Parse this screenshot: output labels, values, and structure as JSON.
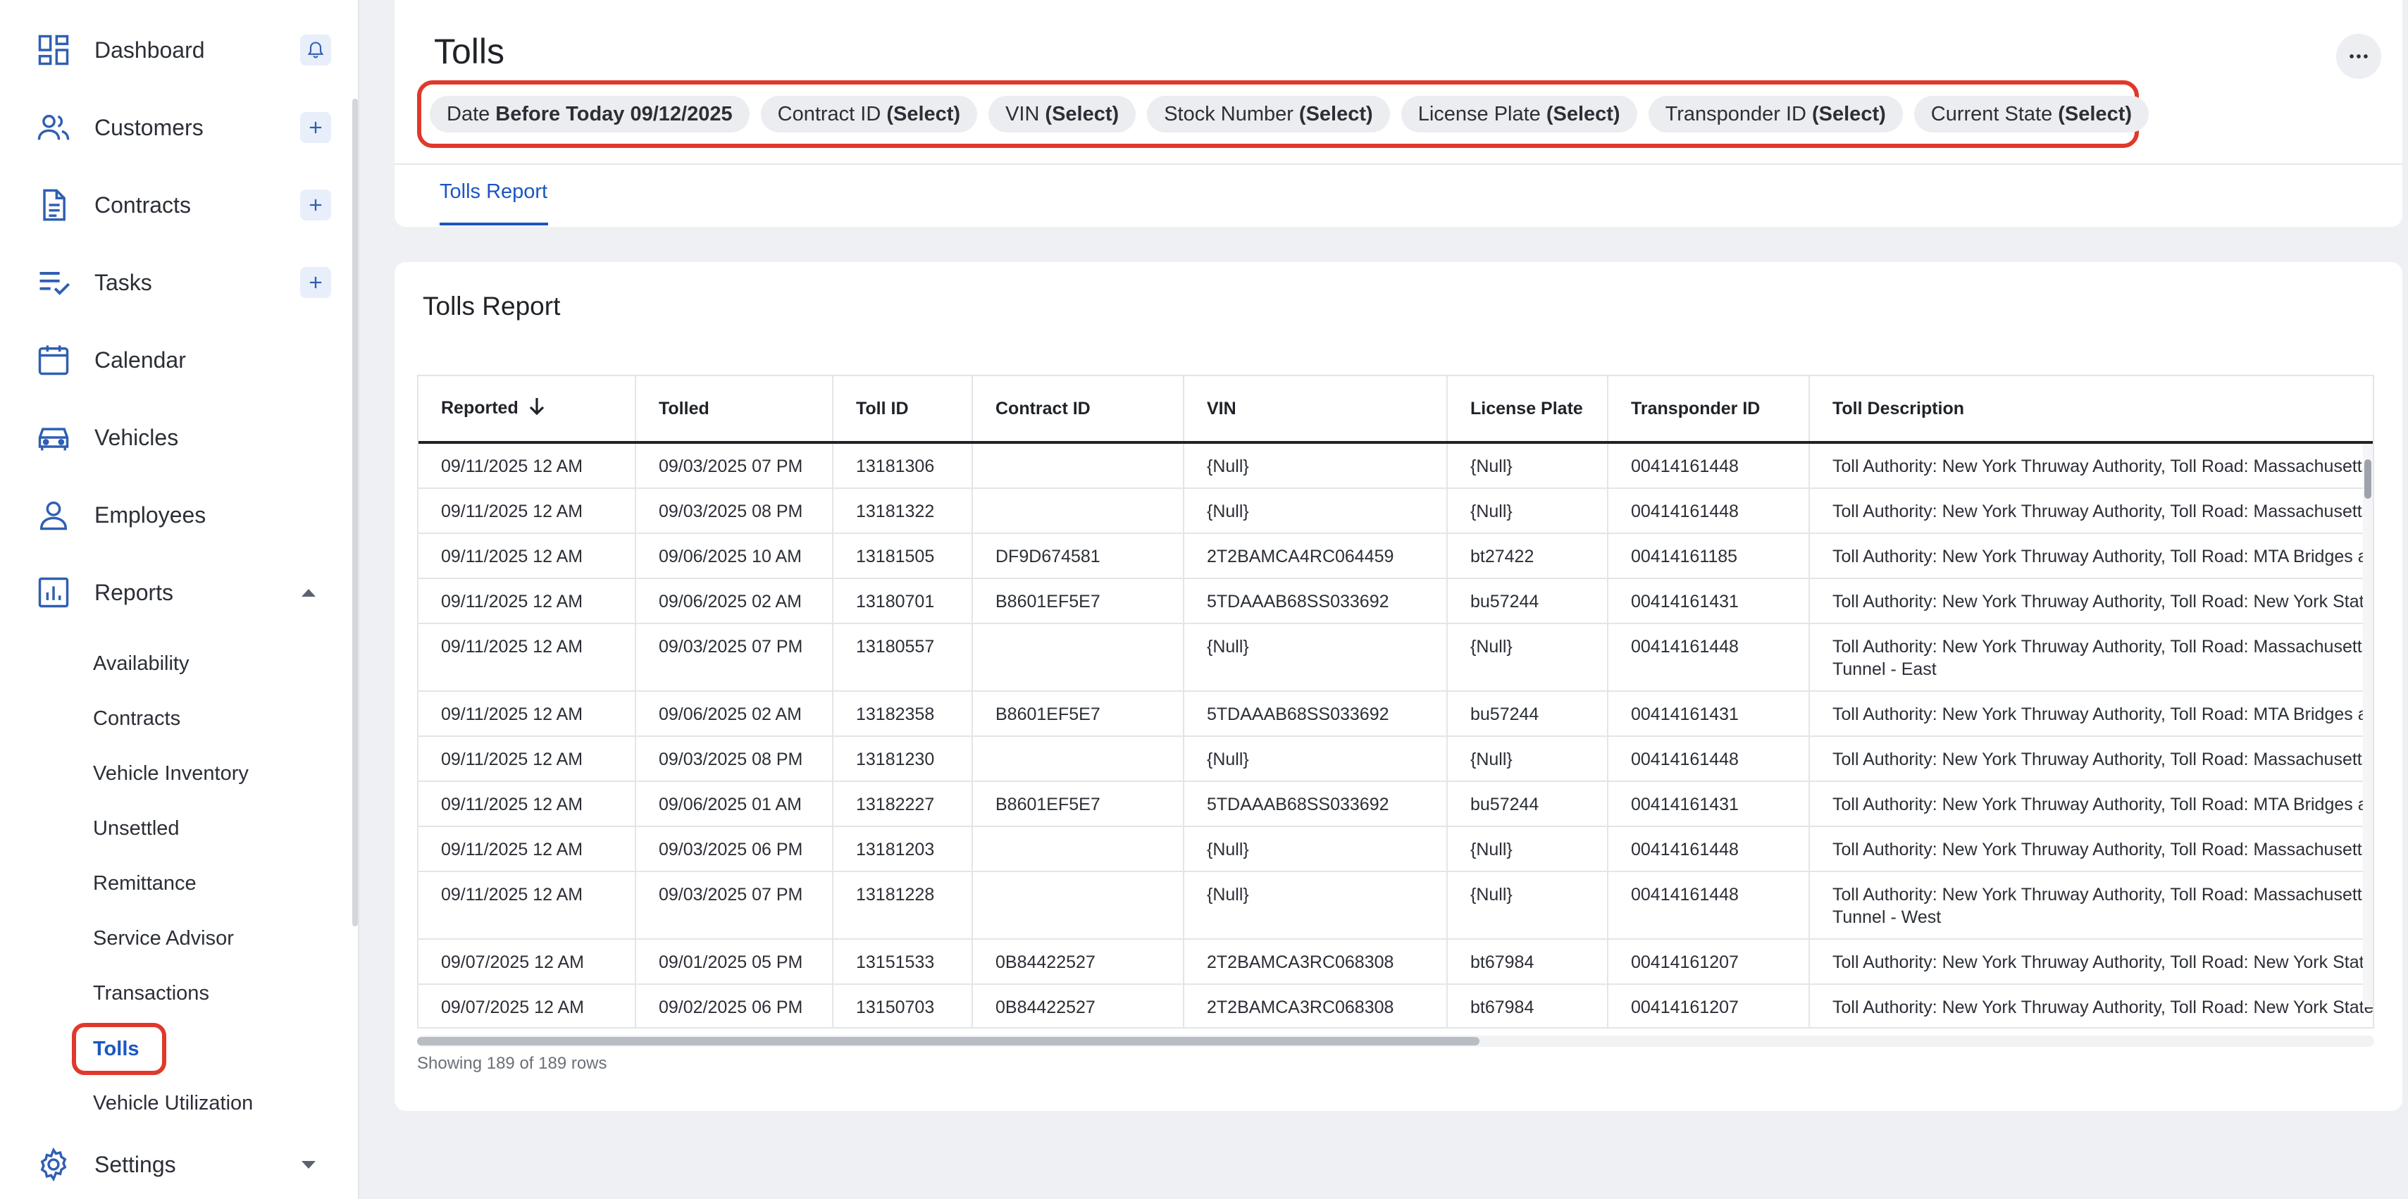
{
  "sidebar": {
    "items": [
      {
        "label": "Dashboard",
        "icon": "dashboard-icon",
        "action": "bell-icon"
      },
      {
        "label": "Customers",
        "icon": "customers-icon",
        "action": "plus-icon"
      },
      {
        "label": "Contracts",
        "icon": "contracts-icon",
        "action": "plus-icon"
      },
      {
        "label": "Tasks",
        "icon": "tasks-icon",
        "action": "plus-icon"
      },
      {
        "label": "Calendar",
        "icon": "calendar-icon"
      },
      {
        "label": "Vehicles",
        "icon": "car-icon"
      },
      {
        "label": "Employees",
        "icon": "person-icon"
      },
      {
        "label": "Reports",
        "icon": "chart-icon",
        "expanded": true
      },
      {
        "label": "Settings",
        "icon": "gear-icon",
        "expanded": false
      }
    ],
    "reports_subitems": [
      {
        "label": "Availability"
      },
      {
        "label": "Contracts"
      },
      {
        "label": "Vehicle Inventory"
      },
      {
        "label": "Unsettled"
      },
      {
        "label": "Remittance"
      },
      {
        "label": "Service Advisor"
      },
      {
        "label": "Transactions"
      },
      {
        "label": "Tolls",
        "active": true
      },
      {
        "label": "Vehicle Utilization"
      }
    ]
  },
  "header": {
    "title": "Tolls",
    "filters": [
      {
        "name": "Date",
        "value": "Before Today 09/12/2025"
      },
      {
        "name": "Contract ID",
        "value": "(Select)"
      },
      {
        "name": "VIN",
        "value": "(Select)"
      },
      {
        "name": "Stock Number",
        "value": "(Select)"
      },
      {
        "name": "License Plate",
        "value": "(Select)"
      },
      {
        "name": "Transponder ID",
        "value": "(Select)"
      },
      {
        "name": "Current State",
        "value": "(Select)"
      }
    ],
    "tab": "Tolls Report"
  },
  "report": {
    "title": "Tolls Report",
    "columns": [
      "Reported",
      "Tolled",
      "Toll ID",
      "Contract ID",
      "VIN",
      "License Plate",
      "Transponder ID",
      "Toll Description"
    ],
    "rows": [
      [
        "09/11/2025 12 AM",
        "09/03/2025 07 PM",
        "13181306",
        "",
        "{Null}",
        "{Null}",
        "00414161448",
        "Toll Authority: New York Thruway Authority, Toll Road: Massachusetts T"
      ],
      [
        "09/11/2025 12 AM",
        "09/03/2025 08 PM",
        "13181322",
        "",
        "{Null}",
        "{Null}",
        "00414161448",
        "Toll Authority: New York Thruway Authority, Toll Road: Massachusetts T"
      ],
      [
        "09/11/2025 12 AM",
        "09/06/2025 10 AM",
        "13181505",
        "DF9D674581",
        "2T2BAMCA4RC064459",
        "bt27422",
        "00414161185",
        "Toll Authority: New York Thruway Authority, Toll Road: MTA Bridges and"
      ],
      [
        "09/11/2025 12 AM",
        "09/06/2025 02 AM",
        "13180701",
        "B8601EF5E7",
        "5TDAAAB68SS033692",
        "bu57244",
        "00414161431",
        "Toll Authority: New York Thruway Authority, Toll Road: New York State T"
      ],
      [
        "09/11/2025 12 AM",
        "09/03/2025 07 PM",
        "13180557",
        "",
        "{Null}",
        "{Null}",
        "00414161448",
        "Toll Authority: New York Thruway Authority, Toll Road: Massachusetts T\nTunnel - East"
      ],
      [
        "09/11/2025 12 AM",
        "09/06/2025 02 AM",
        "13182358",
        "B8601EF5E7",
        "5TDAAAB68SS033692",
        "bu57244",
        "00414161431",
        "Toll Authority: New York Thruway Authority, Toll Road: MTA Bridges and"
      ],
      [
        "09/11/2025 12 AM",
        "09/03/2025 08 PM",
        "13181230",
        "",
        "{Null}",
        "{Null}",
        "00414161448",
        "Toll Authority: New York Thruway Authority, Toll Road: Massachusetts T"
      ],
      [
        "09/11/2025 12 AM",
        "09/06/2025 01 AM",
        "13182227",
        "B8601EF5E7",
        "5TDAAAB68SS033692",
        "bu57244",
        "00414161431",
        "Toll Authority: New York Thruway Authority, Toll Road: MTA Bridges and"
      ],
      [
        "09/11/2025 12 AM",
        "09/03/2025 06 PM",
        "13181203",
        "",
        "{Null}",
        "{Null}",
        "00414161448",
        "Toll Authority: New York Thruway Authority, Toll Road: Massachusetts T"
      ],
      [
        "09/11/2025 12 AM",
        "09/03/2025 07 PM",
        "13181228",
        "",
        "{Null}",
        "{Null}",
        "00414161448",
        "Toll Authority: New York Thruway Authority, Toll Road: Massachusetts T\nTunnel - West"
      ],
      [
        "09/07/2025 12 AM",
        "09/01/2025 05 PM",
        "13151533",
        "0B84422527",
        "2T2BAMCA3RC068308",
        "bt67984",
        "00414161207",
        "Toll Authority: New York Thruway Authority, Toll Road: New York State T"
      ],
      [
        "09/07/2025 12 AM",
        "09/02/2025 06 PM",
        "13150703",
        "0B84422527",
        "2T2BAMCA3RC068308",
        "bt67984",
        "00414161207",
        "Toll Authority: New York Thruway Authority, Toll Road: New York State T"
      ]
    ],
    "row_count": "Showing 189 of 189 rows"
  },
  "colors": {
    "accent": "#1a56c4",
    "highlight": "#e0392b",
    "icon": "#2f5fb3"
  }
}
